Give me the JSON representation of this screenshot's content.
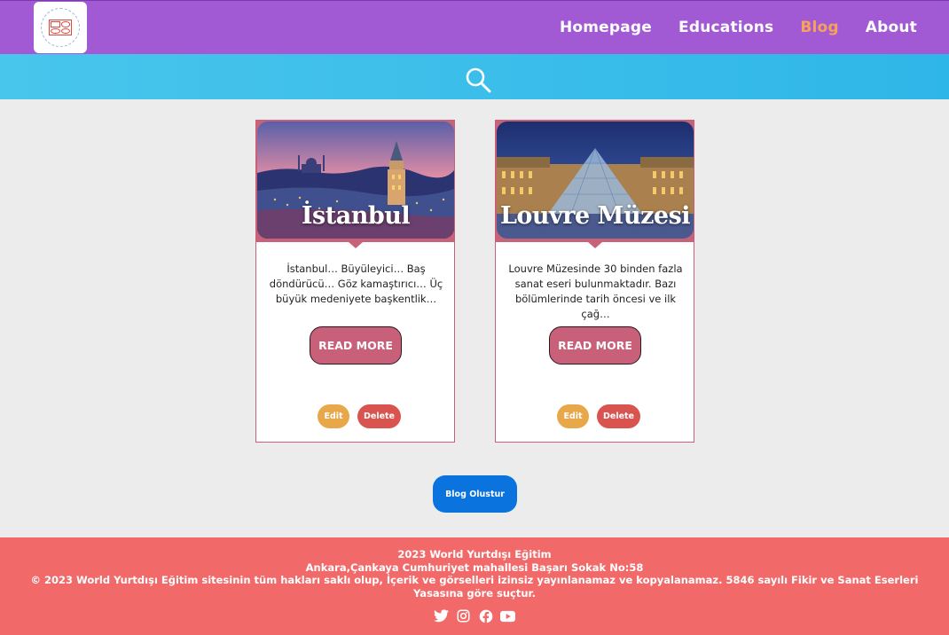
{
  "nav": {
    "logo_icon": "brand-logo-icon",
    "links": [
      "Homepage",
      "Educations",
      "Blog",
      "About"
    ],
    "active": "Blog",
    "active_color": "#f6a25a"
  },
  "search": {
    "icon": "search-icon"
  },
  "cards": [
    {
      "image_title": "İstanbul",
      "excerpt": "İstanbul… Büyüleyici… Baş döndürücü… Göz kamaştırıcı… Üç büyük medeniyete başkentlik…",
      "read_more": "READ MORE",
      "edit": "Edit",
      "delete": "Delete"
    },
    {
      "image_title": "Louvre Müzesi",
      "excerpt": "Louvre Müzesinde 30 binden fazla sanat eseri bulunmaktadır. Bazı bölümlerinde tarih öncesi ve ilk çağ…",
      "read_more": "READ MORE",
      "edit": "Edit",
      "delete": "Delete"
    }
  ],
  "create_button": "Blog Olustur",
  "footer": {
    "line1": "2023 World Yurtdışı Eğitim",
    "line2": "Ankara,Çankaya Cumhuriyet mahallesi Başarı Sokak No:58",
    "line3": "© 2023 World Yurtdışı Eğitim sitesinin tüm hakları saklı olup, İçerik ve görselleri izinsiz yayınlanamaz ve kopyalanamaz. 5846 sayılı Fikir ve Sanat Eserleri Yasasına göre suçtur.",
    "social_icons": [
      "twitter-icon",
      "instagram-icon",
      "facebook-icon",
      "youtube-icon"
    ]
  },
  "colors": {
    "navbar": "#a259d4",
    "searchbar": "#38bdea",
    "card_accent": "#c8607a",
    "edit": "#e8a84a",
    "delete": "#d9534f",
    "create": "#0a73dd",
    "footer": "#f2696a"
  }
}
